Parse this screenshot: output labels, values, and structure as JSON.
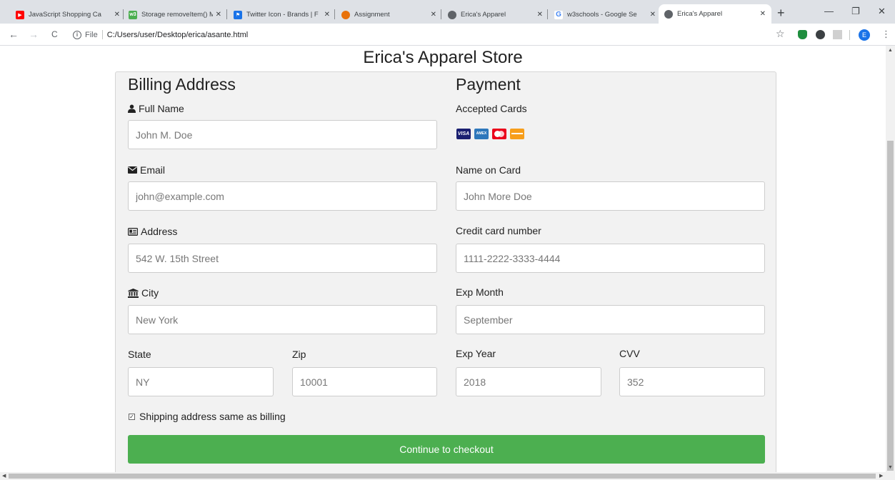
{
  "browser": {
    "tabs": [
      {
        "label": "JavaScript Shopping Ca",
        "close": "✕",
        "favicon": "youtube-icon",
        "color": "#ff0000"
      },
      {
        "label": "Storage removeItem() M",
        "close": "✕",
        "favicon": "w3schools-icon",
        "color": "#4caf50"
      },
      {
        "label": "Twitter Icon - Brands | F",
        "close": "✕",
        "favicon": "flag-icon",
        "color": "#1a73e8"
      },
      {
        "label": "Assignment",
        "close": "✕",
        "favicon": "shield-icon",
        "color": "#e8710a"
      },
      {
        "label": "Erica's Apparel",
        "close": "✕",
        "favicon": "globe-icon",
        "color": "#5f6368"
      },
      {
        "label": "w3schools - Google Se",
        "close": "✕",
        "favicon": "google-icon",
        "color": "#4285f4"
      },
      {
        "label": "Erica's Apparel",
        "close": "✕",
        "favicon": "globe-icon",
        "color": "#5f6368"
      }
    ],
    "new_tab": "+",
    "window_controls": {
      "minimize": "—",
      "restore": "❐",
      "close": "✕"
    },
    "nav": {
      "back": "←",
      "forward": "→",
      "reload": "C"
    },
    "address": {
      "info": "i",
      "scheme_label": "File",
      "url": "C:/Users/user/Desktop/erica/asante.html"
    },
    "star": "☆",
    "profile_initial": "E",
    "menu": "⋮"
  },
  "page": {
    "title": "Erica's Apparel Store",
    "billing": {
      "heading": "Billing Address",
      "full_name": {
        "label": "Full Name",
        "placeholder": "John M. Doe",
        "icon": "user-icon"
      },
      "email": {
        "label": "Email",
        "placeholder": "john@example.com",
        "icon": "envelope-icon"
      },
      "address": {
        "label": "Address",
        "placeholder": "542 W. 15th Street",
        "icon": "address-card-icon"
      },
      "city": {
        "label": "City",
        "placeholder": "New York",
        "icon": "institution-icon"
      },
      "state": {
        "label": "State",
        "placeholder": "NY"
      },
      "zip": {
        "label": "Zip",
        "placeholder": "10001"
      }
    },
    "payment": {
      "heading": "Payment",
      "accepted_label": "Accepted Cards",
      "cards": [
        {
          "name": "visa-icon",
          "text": "VISA",
          "color": "#1a1f71"
        },
        {
          "name": "amex-icon",
          "text": "AMEX",
          "color": "#2e77bb"
        },
        {
          "name": "mastercard-icon",
          "text": "",
          "color": "#eb001b"
        },
        {
          "name": "discover-icon",
          "text": "",
          "color": "#f79e1b"
        }
      ],
      "name_on_card": {
        "label": "Name on Card",
        "placeholder": "John More Doe"
      },
      "card_number": {
        "label": "Credit card number",
        "placeholder": "1111-2222-3333-4444"
      },
      "exp_month": {
        "label": "Exp Month",
        "placeholder": "September"
      },
      "exp_year": {
        "label": "Exp Year",
        "placeholder": "2018"
      },
      "cvv": {
        "label": "CVV",
        "placeholder": "352"
      }
    },
    "shipping_same": {
      "label": "Shipping address same as billing",
      "checked": true
    },
    "checkout_button": "Continue to checkout",
    "colors": {
      "accent": "#4caf50",
      "card_bg": "#f2f2f2"
    }
  }
}
